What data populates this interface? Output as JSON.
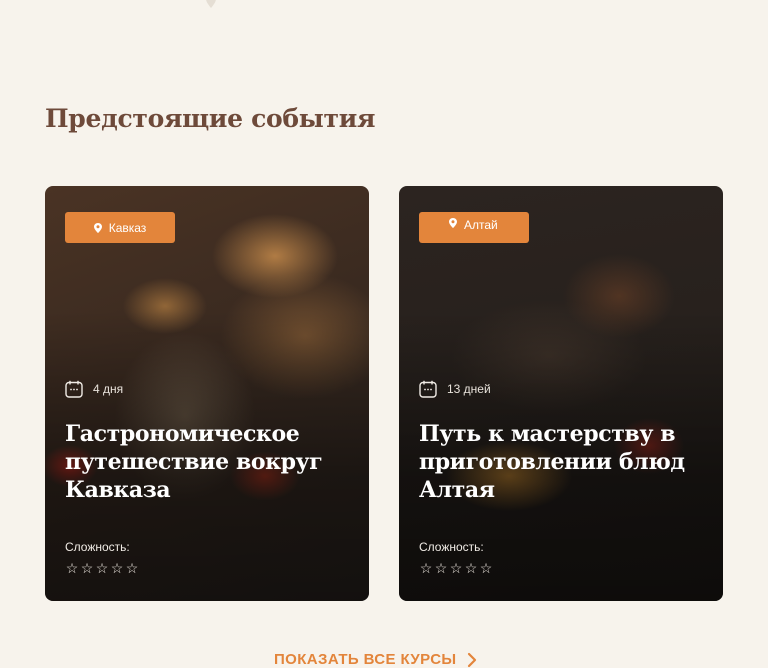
{
  "section": {
    "title": "Предстоящие события"
  },
  "cards": [
    {
      "region": "Кавказ",
      "duration": "4 дня",
      "title": "Гастрономическое путешествие вокруг Кавказа",
      "difficulty_label": "Сложность:",
      "difficulty_rating": 0,
      "difficulty_max": 5
    },
    {
      "region": "Алтай",
      "duration": "13 дней",
      "title": "Путь к мастерству в приготовлении блюд Алтая",
      "difficulty_label": "Сложность:",
      "difficulty_rating": 0,
      "difficulty_max": 5
    }
  ],
  "cta": {
    "label": "ПОКАЗАТЬ ВСЕ КУРСЫ"
  },
  "icons": {
    "tag_pin": "map-pin-icon",
    "duration": "calendar-icon",
    "star": "star-outline-icon",
    "cta": "chevron-right-icon"
  },
  "colors": {
    "accent": "#e3853b",
    "heading": "#6e4a3a",
    "background": "#f7f3ec"
  }
}
